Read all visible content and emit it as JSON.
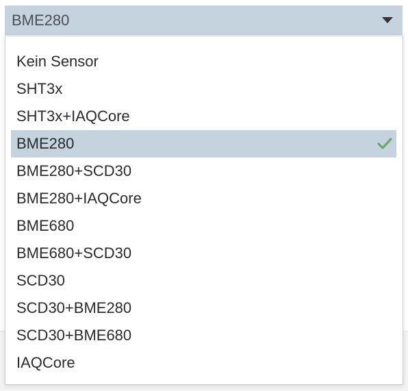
{
  "select": {
    "value": "BME280",
    "caret_icon": "caret-down-icon"
  },
  "menu": {
    "selected_index": 3,
    "check_icon": "checkmark-icon",
    "check_color": "#6aa86a",
    "highlight_color": "#c5d3df",
    "items": [
      {
        "label": "Kein Sensor"
      },
      {
        "label": "SHT3x"
      },
      {
        "label": "SHT3x+IAQCore"
      },
      {
        "label": "BME280"
      },
      {
        "label": "BME280+SCD30"
      },
      {
        "label": "BME280+IAQCore"
      },
      {
        "label": "BME680"
      },
      {
        "label": "BME680+SCD30"
      },
      {
        "label": "SCD30"
      },
      {
        "label": "SCD30+BME280"
      },
      {
        "label": "SCD30+BME680"
      },
      {
        "label": "IAQCore"
      }
    ]
  }
}
